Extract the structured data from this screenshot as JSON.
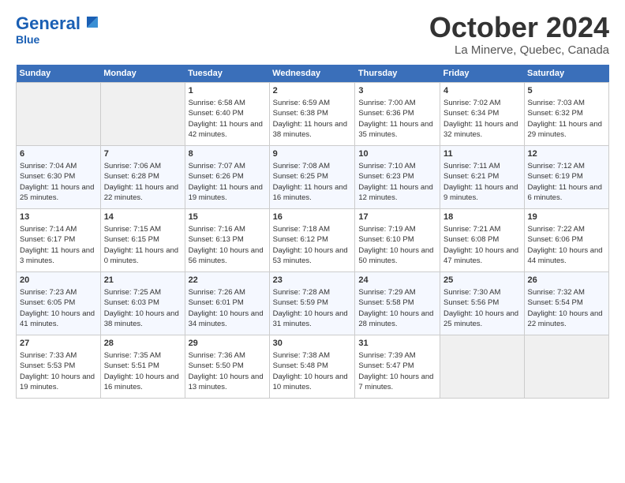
{
  "header": {
    "logo_line1": "General",
    "logo_line2": "Blue",
    "month": "October 2024",
    "location": "La Minerve, Quebec, Canada"
  },
  "days_of_week": [
    "Sunday",
    "Monday",
    "Tuesday",
    "Wednesday",
    "Thursday",
    "Friday",
    "Saturday"
  ],
  "weeks": [
    [
      {
        "day": null
      },
      {
        "day": null
      },
      {
        "day": 1,
        "sunrise": "6:58 AM",
        "sunset": "6:40 PM",
        "daylight": "11 hours and 42 minutes."
      },
      {
        "day": 2,
        "sunrise": "6:59 AM",
        "sunset": "6:38 PM",
        "daylight": "11 hours and 38 minutes."
      },
      {
        "day": 3,
        "sunrise": "7:00 AM",
        "sunset": "6:36 PM",
        "daylight": "11 hours and 35 minutes."
      },
      {
        "day": 4,
        "sunrise": "7:02 AM",
        "sunset": "6:34 PM",
        "daylight": "11 hours and 32 minutes."
      },
      {
        "day": 5,
        "sunrise": "7:03 AM",
        "sunset": "6:32 PM",
        "daylight": "11 hours and 29 minutes."
      }
    ],
    [
      {
        "day": 6,
        "sunrise": "7:04 AM",
        "sunset": "6:30 PM",
        "daylight": "11 hours and 25 minutes."
      },
      {
        "day": 7,
        "sunrise": "7:06 AM",
        "sunset": "6:28 PM",
        "daylight": "11 hours and 22 minutes."
      },
      {
        "day": 8,
        "sunrise": "7:07 AM",
        "sunset": "6:26 PM",
        "daylight": "11 hours and 19 minutes."
      },
      {
        "day": 9,
        "sunrise": "7:08 AM",
        "sunset": "6:25 PM",
        "daylight": "11 hours and 16 minutes."
      },
      {
        "day": 10,
        "sunrise": "7:10 AM",
        "sunset": "6:23 PM",
        "daylight": "11 hours and 12 minutes."
      },
      {
        "day": 11,
        "sunrise": "7:11 AM",
        "sunset": "6:21 PM",
        "daylight": "11 hours and 9 minutes."
      },
      {
        "day": 12,
        "sunrise": "7:12 AM",
        "sunset": "6:19 PM",
        "daylight": "11 hours and 6 minutes."
      }
    ],
    [
      {
        "day": 13,
        "sunrise": "7:14 AM",
        "sunset": "6:17 PM",
        "daylight": "11 hours and 3 minutes."
      },
      {
        "day": 14,
        "sunrise": "7:15 AM",
        "sunset": "6:15 PM",
        "daylight": "11 hours and 0 minutes."
      },
      {
        "day": 15,
        "sunrise": "7:16 AM",
        "sunset": "6:13 PM",
        "daylight": "10 hours and 56 minutes."
      },
      {
        "day": 16,
        "sunrise": "7:18 AM",
        "sunset": "6:12 PM",
        "daylight": "10 hours and 53 minutes."
      },
      {
        "day": 17,
        "sunrise": "7:19 AM",
        "sunset": "6:10 PM",
        "daylight": "10 hours and 50 minutes."
      },
      {
        "day": 18,
        "sunrise": "7:21 AM",
        "sunset": "6:08 PM",
        "daylight": "10 hours and 47 minutes."
      },
      {
        "day": 19,
        "sunrise": "7:22 AM",
        "sunset": "6:06 PM",
        "daylight": "10 hours and 44 minutes."
      }
    ],
    [
      {
        "day": 20,
        "sunrise": "7:23 AM",
        "sunset": "6:05 PM",
        "daylight": "10 hours and 41 minutes."
      },
      {
        "day": 21,
        "sunrise": "7:25 AM",
        "sunset": "6:03 PM",
        "daylight": "10 hours and 38 minutes."
      },
      {
        "day": 22,
        "sunrise": "7:26 AM",
        "sunset": "6:01 PM",
        "daylight": "10 hours and 34 minutes."
      },
      {
        "day": 23,
        "sunrise": "7:28 AM",
        "sunset": "5:59 PM",
        "daylight": "10 hours and 31 minutes."
      },
      {
        "day": 24,
        "sunrise": "7:29 AM",
        "sunset": "5:58 PM",
        "daylight": "10 hours and 28 minutes."
      },
      {
        "day": 25,
        "sunrise": "7:30 AM",
        "sunset": "5:56 PM",
        "daylight": "10 hours and 25 minutes."
      },
      {
        "day": 26,
        "sunrise": "7:32 AM",
        "sunset": "5:54 PM",
        "daylight": "10 hours and 22 minutes."
      }
    ],
    [
      {
        "day": 27,
        "sunrise": "7:33 AM",
        "sunset": "5:53 PM",
        "daylight": "10 hours and 19 minutes."
      },
      {
        "day": 28,
        "sunrise": "7:35 AM",
        "sunset": "5:51 PM",
        "daylight": "10 hours and 16 minutes."
      },
      {
        "day": 29,
        "sunrise": "7:36 AM",
        "sunset": "5:50 PM",
        "daylight": "10 hours and 13 minutes."
      },
      {
        "day": 30,
        "sunrise": "7:38 AM",
        "sunset": "5:48 PM",
        "daylight": "10 hours and 10 minutes."
      },
      {
        "day": 31,
        "sunrise": "7:39 AM",
        "sunset": "5:47 PM",
        "daylight": "10 hours and 7 minutes."
      },
      {
        "day": null
      },
      {
        "day": null
      }
    ]
  ]
}
